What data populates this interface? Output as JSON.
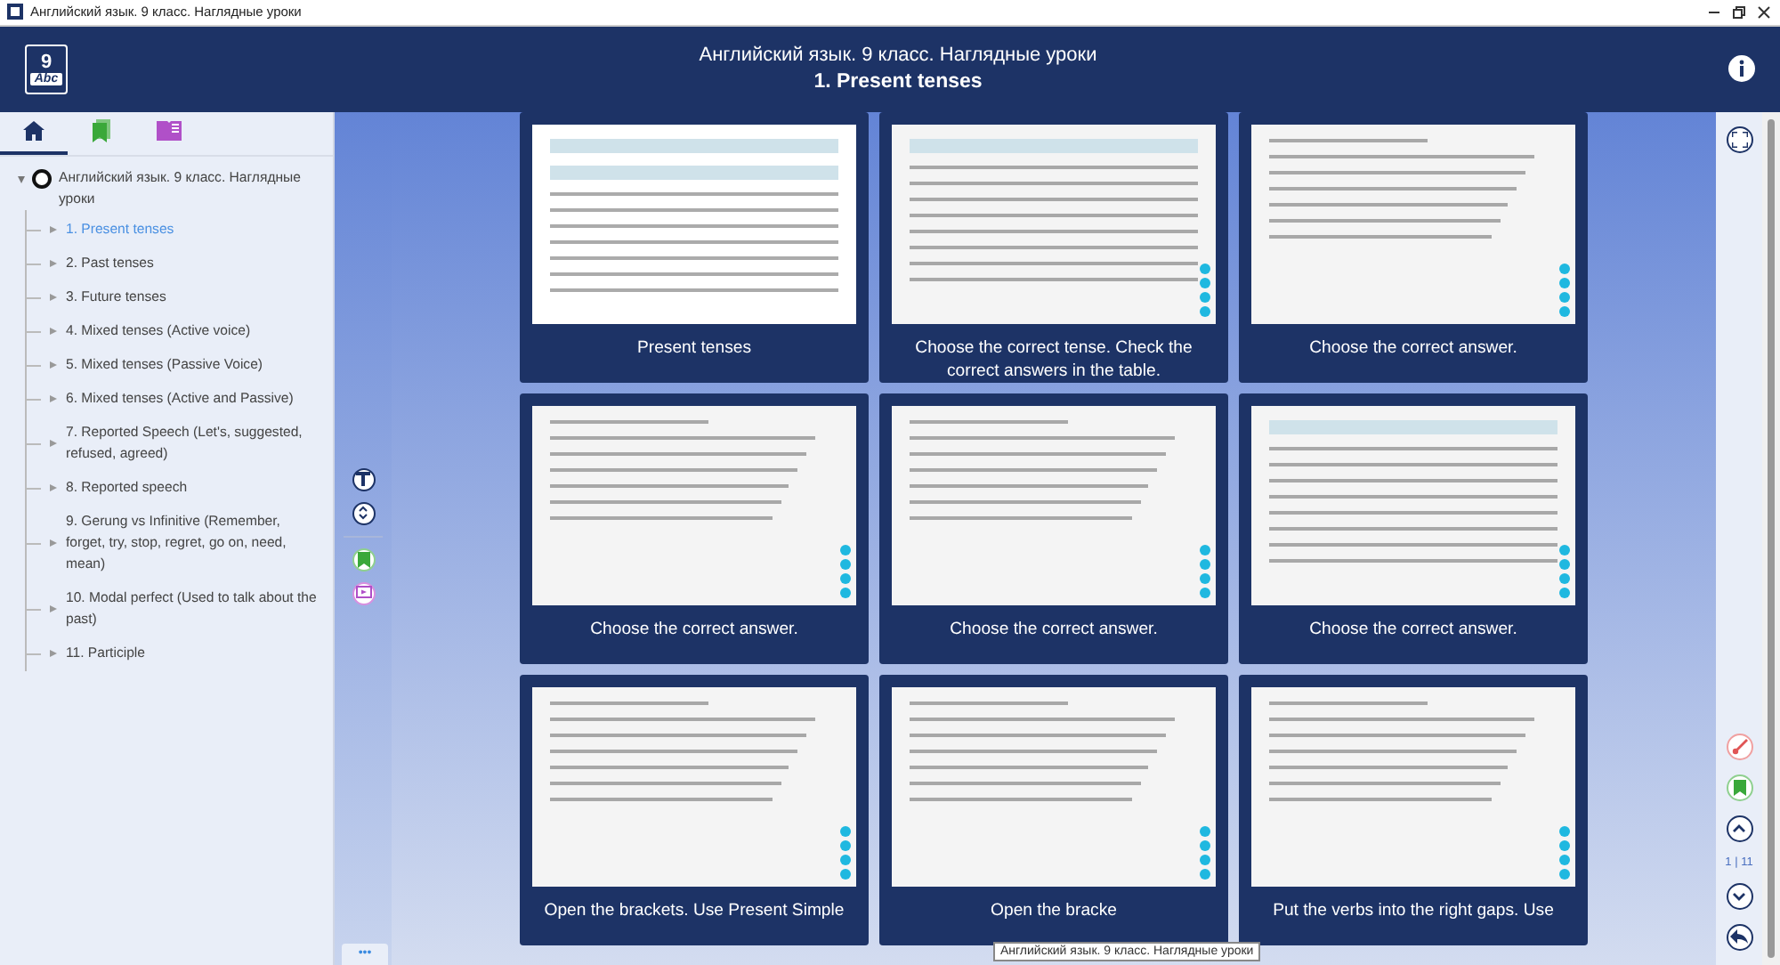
{
  "window": {
    "title": "Английский язык. 9 класс. Наглядные уроки"
  },
  "header": {
    "logo_number": "9",
    "logo_text": "Abc",
    "title": "Английский язык. 9 класс. Наглядные уроки",
    "subtitle": "1. Present tenses"
  },
  "sidebar": {
    "tabs": [
      {
        "kind": "home",
        "selected": true
      },
      {
        "kind": "bookmarks",
        "selected": false
      },
      {
        "kind": "book",
        "selected": false
      }
    ],
    "tree": {
      "label": "Английский язык. 9 класс. Наглядные уроки",
      "expanded": true,
      "children": [
        {
          "label": "1. Present tenses",
          "selected": true
        },
        {
          "label": "2. Past tenses",
          "selected": false
        },
        {
          "label": "3. Future tenses",
          "selected": false
        },
        {
          "label": "4. Mixed tenses (Active voice)",
          "selected": false
        },
        {
          "label": "5. Mixed tenses (Passive Voice)",
          "selected": false
        },
        {
          "label": "6. Mixed tenses (Active and Passive)",
          "selected": false
        },
        {
          "label": "7. Reported Speech (Let's, suggested, refused, agreed)",
          "selected": false
        },
        {
          "label": "8. Reported speech",
          "selected": false
        },
        {
          "label": "9. Gerung vs Infinitive (Remember, forget, try, stop, regret, go on, need, mean)",
          "selected": false
        },
        {
          "label": "10. Modal perfect (Used to talk about the past)",
          "selected": false
        },
        {
          "label": "11. Participle",
          "selected": false
        }
      ]
    },
    "more_button": "•••"
  },
  "side_tools": [
    {
      "kind": "filter"
    },
    {
      "kind": "expand"
    },
    {
      "kind": "bookmark"
    },
    {
      "kind": "screen"
    }
  ],
  "cards": [
    {
      "kind": "table",
      "caption": "Present tenses"
    },
    {
      "kind": "grid",
      "caption": "Choose the correct tense. Check the correct answers in the table."
    },
    {
      "kind": "gaps",
      "caption": "Choose the correct answer."
    },
    {
      "kind": "gaps",
      "caption": "Choose the correct answer."
    },
    {
      "kind": "gaps",
      "caption": "Choose the correct answer."
    },
    {
      "kind": "grid",
      "caption": "Choose the correct answer."
    },
    {
      "kind": "gaps",
      "caption": "Open the brackets. Use Present Simple"
    },
    {
      "kind": "gaps",
      "caption": "Open the bracke"
    },
    {
      "kind": "gaps",
      "caption": "Put the verbs into the right gaps. Use"
    }
  ],
  "tooltip": "Английский язык. 9 класс. Наглядные уроки",
  "right_rail": {
    "top": [
      {
        "kind": "fullscreen"
      }
    ],
    "bottom": [
      {
        "kind": "draw"
      },
      {
        "kind": "bookmark"
      },
      {
        "kind": "up"
      },
      {
        "kind": "pager"
      },
      {
        "kind": "down"
      },
      {
        "kind": "back"
      }
    ],
    "pager": "1 | 11"
  }
}
